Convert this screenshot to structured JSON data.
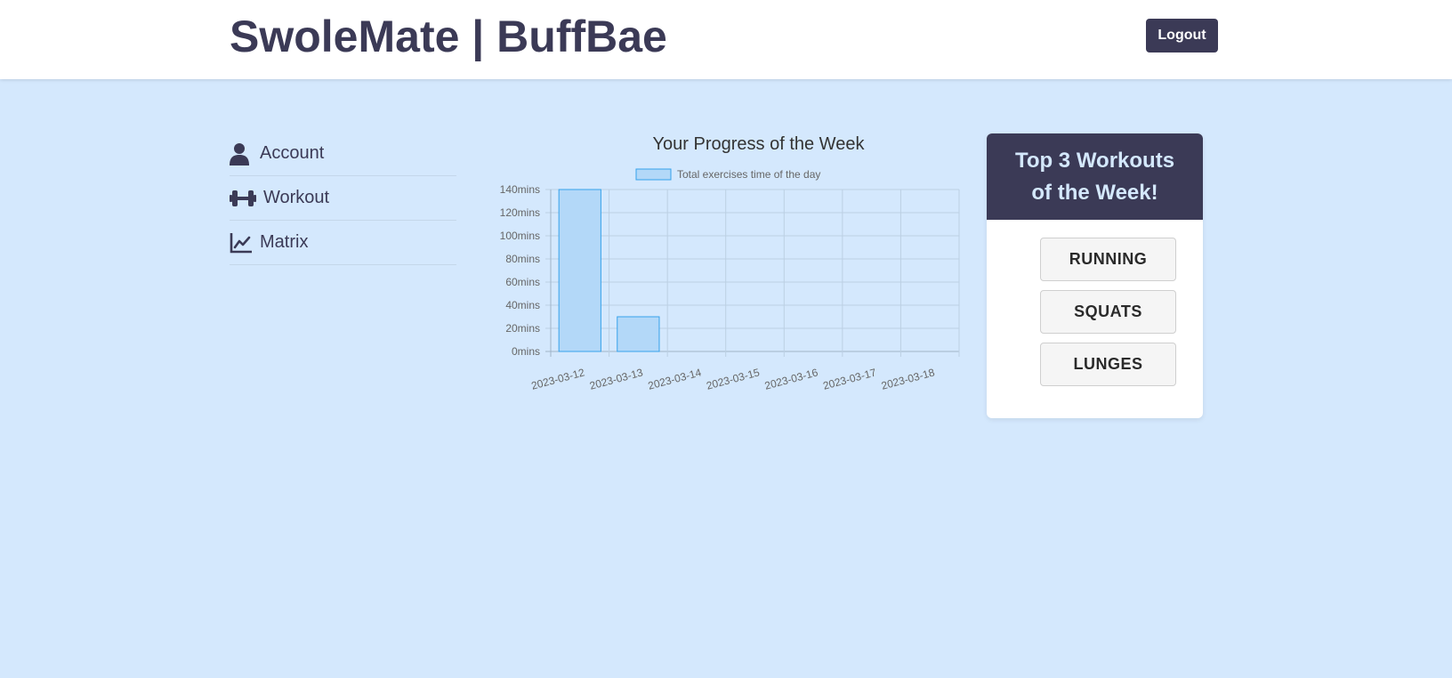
{
  "header": {
    "brand": "SwoleMate | BuffBae",
    "logout_label": "Logout"
  },
  "sidebar": {
    "items": [
      {
        "label": "Account",
        "icon": "user-icon"
      },
      {
        "label": "Workout",
        "icon": "dumbbell-icon"
      },
      {
        "label": "Matrix",
        "icon": "line-chart-icon"
      }
    ]
  },
  "colors": {
    "primary": "#3b3a56",
    "background": "#d4e8fd",
    "bar_fill": "#b3d8f8",
    "bar_stroke": "#36a2eb"
  },
  "chart_data": {
    "type": "bar",
    "title": "Your Progress of the Week",
    "legend": "Total exercises time of the day",
    "legend_position": "top",
    "categories": [
      "2023-03-12",
      "2023-03-13",
      "2023-03-14",
      "2023-03-15",
      "2023-03-16",
      "2023-03-17",
      "2023-03-18"
    ],
    "values": [
      140,
      30,
      0,
      0,
      0,
      0,
      0
    ],
    "yticks": [
      "0mins",
      "20mins",
      "40mins",
      "60mins",
      "80mins",
      "100mins",
      "120mins",
      "140mins"
    ],
    "ylim": [
      0,
      140
    ],
    "xlabel": "",
    "ylabel": "",
    "grid": true
  },
  "top_workouts": {
    "title": "Top 3 Workouts of the Week!",
    "items": [
      "RUNNING",
      "SQUATS",
      "LUNGES"
    ]
  }
}
